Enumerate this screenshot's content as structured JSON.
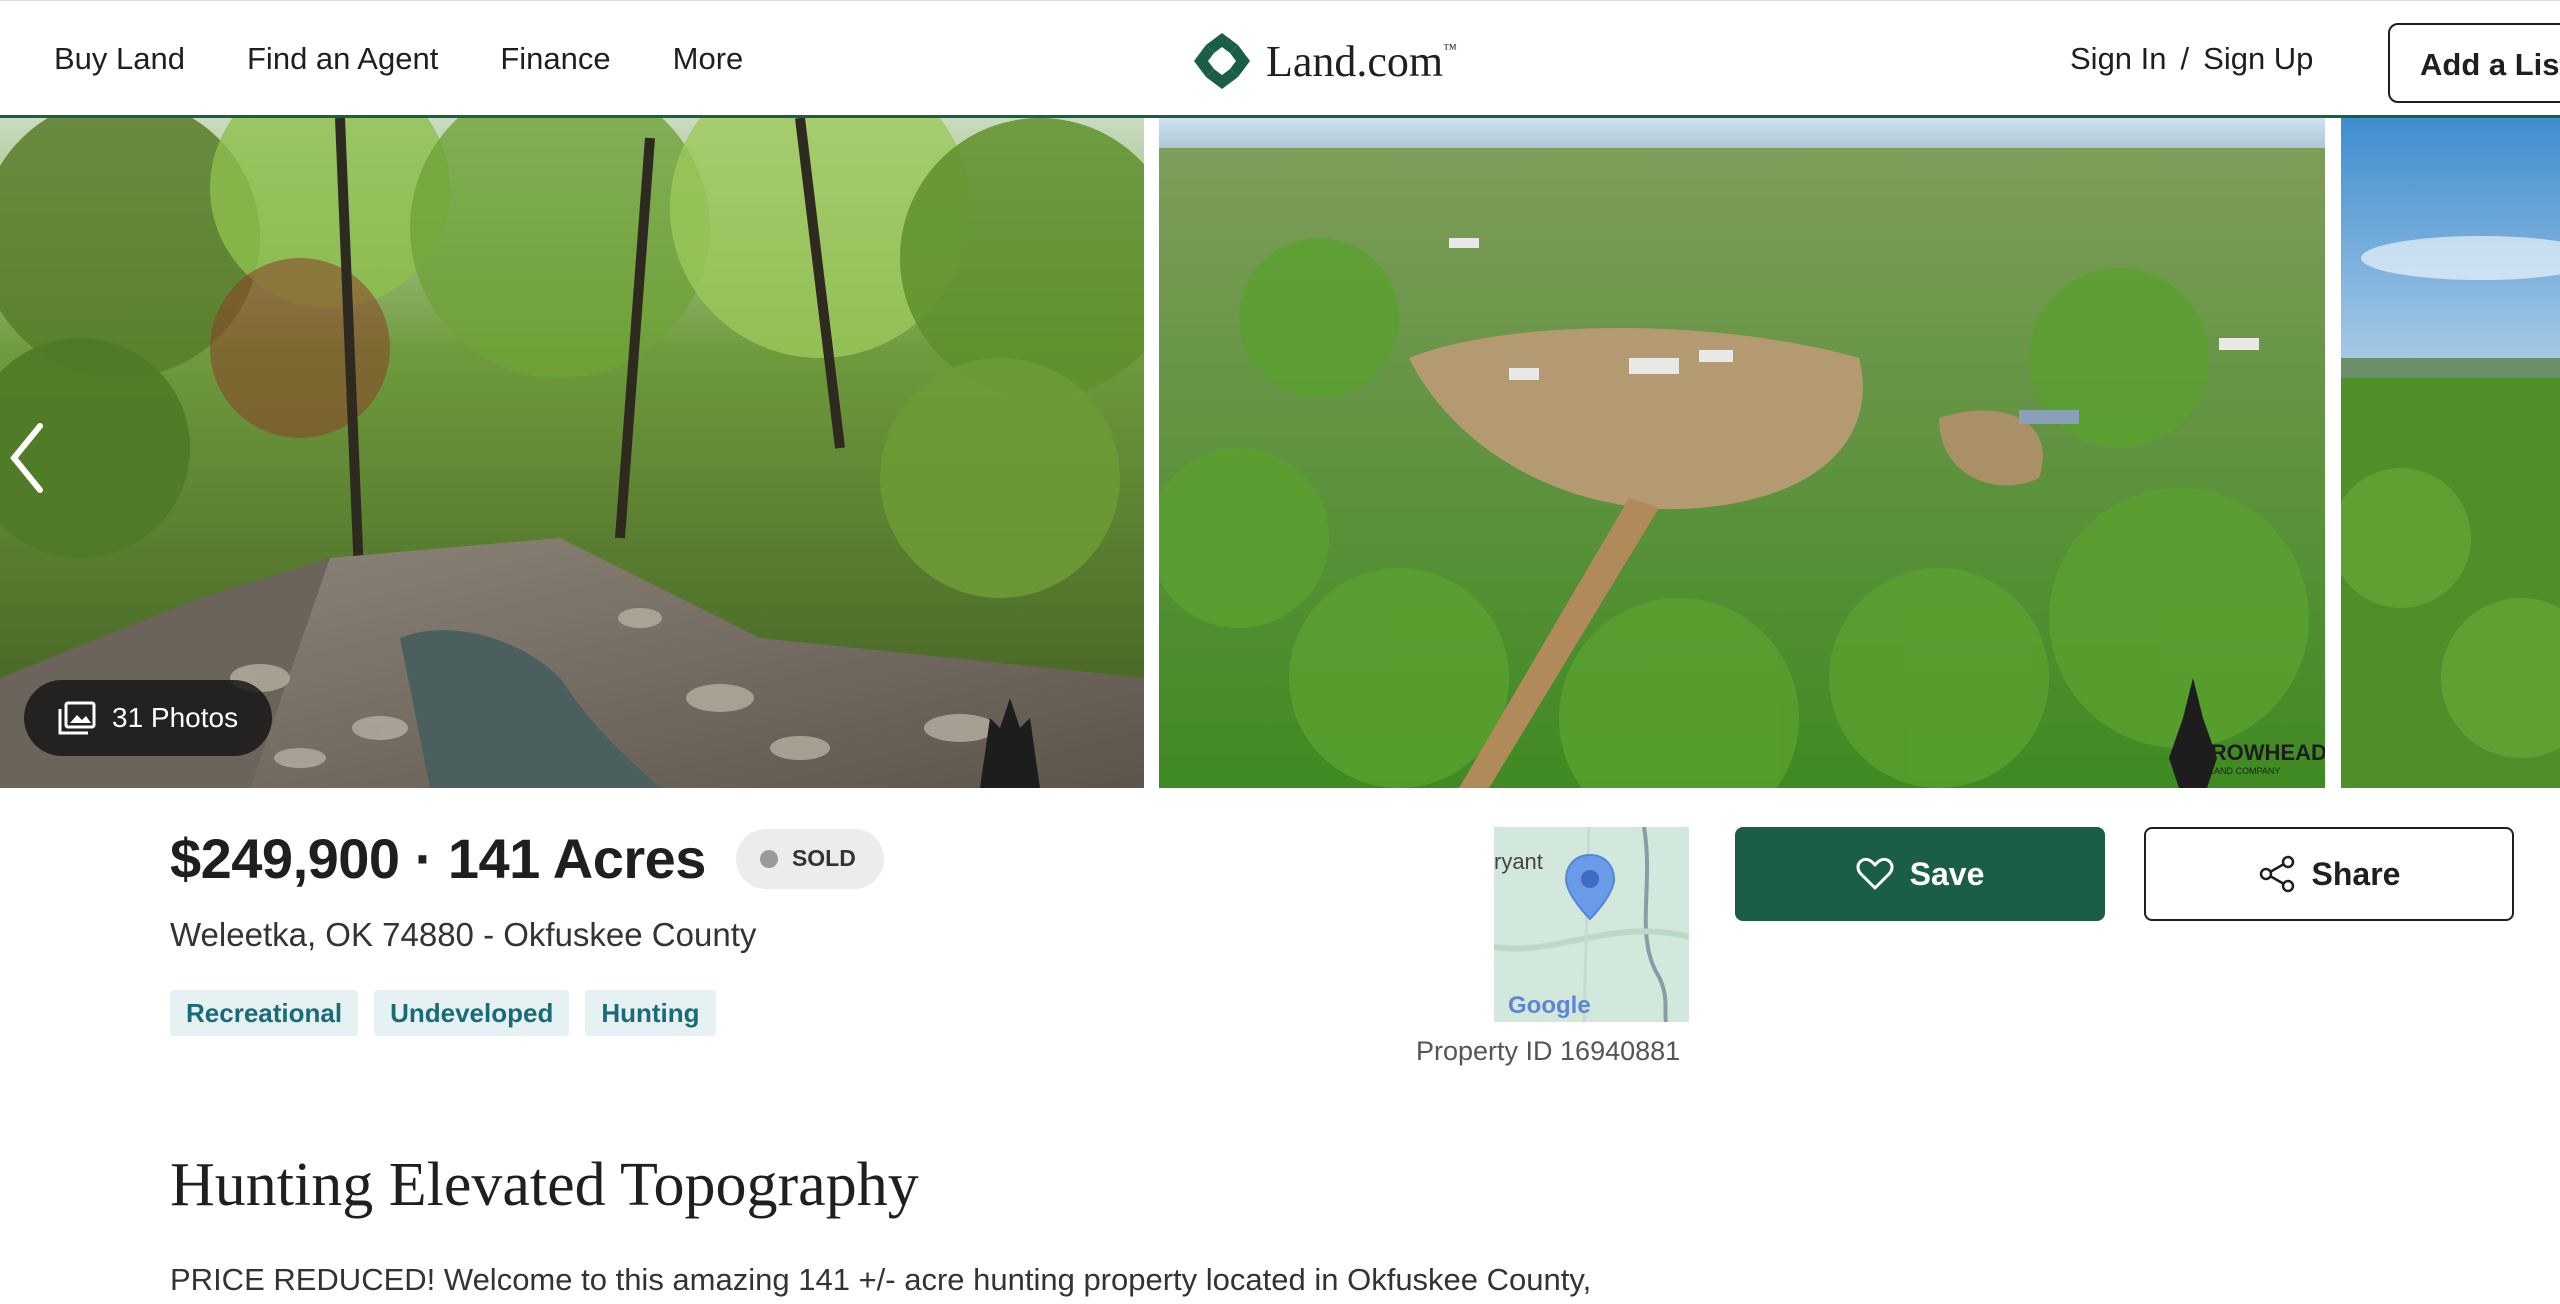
{
  "nav": {
    "links": [
      "Buy Land",
      "Find an Agent",
      "Finance",
      "More"
    ],
    "logo_text": "Land.com",
    "logo_tm": "™",
    "sign_in": "Sign In",
    "separator": "/",
    "sign_up": "Sign Up",
    "add_listing": "Add a Listing",
    "brand_color": "#1b5e46"
  },
  "gallery": {
    "photo_count_label": "31 Photos",
    "watermark_text": "ARROWHEAD",
    "watermark_sub": "LAND COMPANY"
  },
  "listing": {
    "price": "$249,900",
    "dot": "·",
    "acres": "141 Acres",
    "status": "SOLD",
    "address": "Weleetka, OK 74880 - Okfuskee County",
    "tags": [
      "Recreational",
      "Undeveloped",
      "Hunting"
    ],
    "map_label": "ryant",
    "map_brand": "Google",
    "property_id": "Property ID 16940881",
    "save_label": "Save",
    "share_label": "Share",
    "title": "Hunting Elevated Topography",
    "description": "PRICE REDUCED! Welcome to this amazing 141 +/- acre hunting property located in Okfuskee County,"
  }
}
